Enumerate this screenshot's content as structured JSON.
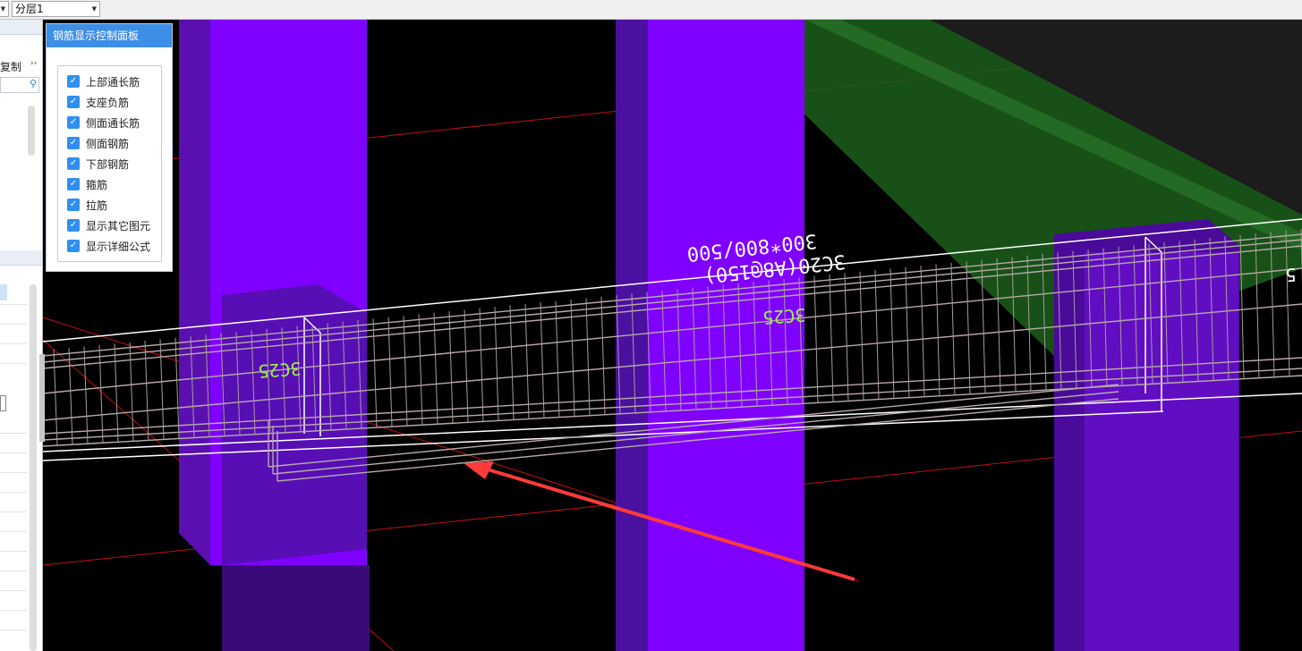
{
  "toolbar": {
    "left_combo_value": "",
    "layer_combo_value": "分层1"
  },
  "sidebar": {
    "copy_label": "复制",
    "more_glyph": "››",
    "search_placeholder": ""
  },
  "control_panel": {
    "title": "钢筋显示控制面板",
    "items": [
      {
        "label": "上部通长筋",
        "checked": true
      },
      {
        "label": "支座负筋",
        "checked": true
      },
      {
        "label": "侧面通长筋",
        "checked": true
      },
      {
        "label": "侧面钢筋",
        "checked": true
      },
      {
        "label": "下部钢筋",
        "checked": true
      },
      {
        "label": "箍筋",
        "checked": true
      },
      {
        "label": "拉筋",
        "checked": true
      },
      {
        "label": "显示其它图元",
        "checked": true
      },
      {
        "label": "显示详细公式",
        "checked": true
      }
    ]
  },
  "drawing": {
    "beam_size_label": "300*800/500",
    "stirrup_label": "3C20(A8@150)",
    "rebar_label_1": "3C25",
    "rebar_label_2": "3C25",
    "rebar_label_3": "5"
  },
  "colors": {
    "column_purple": "#8000ff",
    "dark_purple": "#4a0a9a",
    "green_beam": "#1a5a1a",
    "rebar": "#b8aaa8",
    "grid_red": "#c01010",
    "arrow_red": "#ff3a3a",
    "label_green": "#9cf04a",
    "label_white": "#ffffff"
  }
}
